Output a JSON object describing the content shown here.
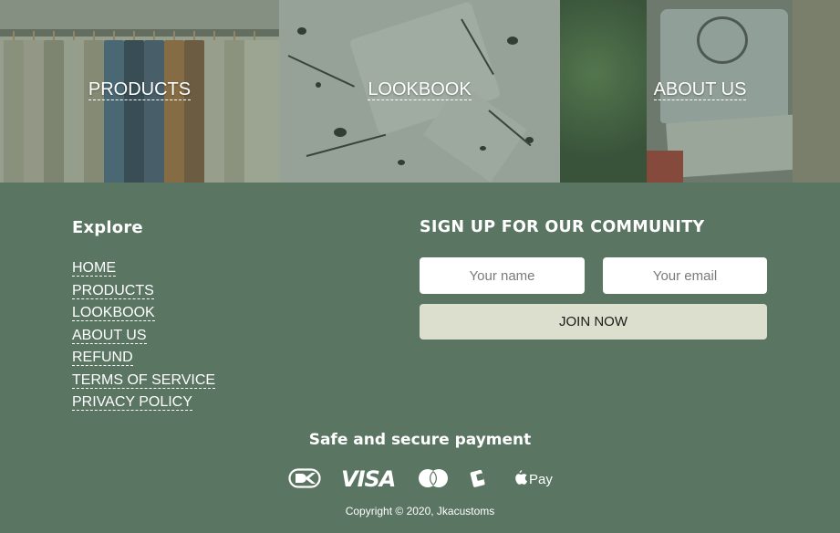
{
  "hero": {
    "tiles": [
      {
        "label": "PRODUCTS"
      },
      {
        "label": "LOOKBOOK"
      },
      {
        "label": "ABOUT US"
      }
    ]
  },
  "explore": {
    "title": "Explore",
    "links": [
      "HOME",
      "PRODUCTS",
      "LOOKBOOK",
      "ABOUT US",
      "REFUND",
      "TERMS OF SERVICE",
      "PRIVACY POLICY"
    ]
  },
  "signup": {
    "title": "SIGN UP FOR OUR COMMUNITY",
    "name_placeholder": "Your name",
    "email_placeholder": "Your email",
    "button_label": "JOIN NOW"
  },
  "payment": {
    "title": "Safe and secure payment",
    "methods": [
      "dankort-icon",
      "visa-icon",
      "mastercard-icon",
      "mobilepay-icon",
      "apple-pay-icon"
    ],
    "visa_text": "VISA",
    "apple_pay_text": "Pay"
  },
  "copyright": "Copyright © 2020, Jkacustoms",
  "colors": {
    "footer_bg": "#5a7562",
    "join_button_bg": "#dcdfcd",
    "text": "#ffffff"
  }
}
